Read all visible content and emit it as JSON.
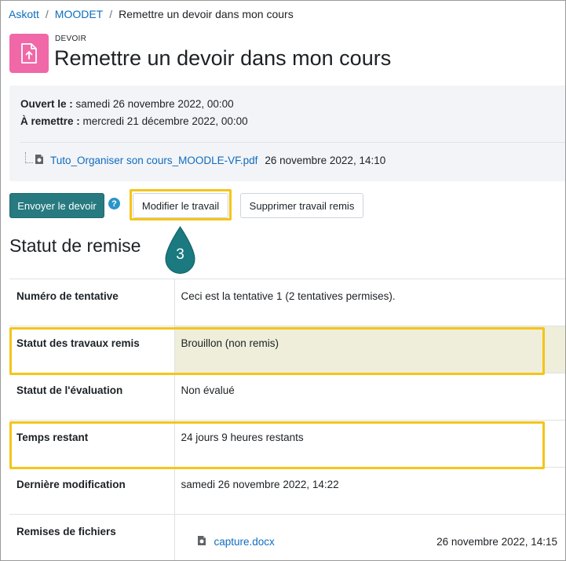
{
  "breadcrumb": [
    {
      "label": "Askott",
      "link": true
    },
    {
      "label": "MOODET",
      "link": true
    },
    {
      "label": "Remettre un devoir dans mon cours",
      "link": false
    }
  ],
  "breadcrumb_separator": "/",
  "activity": {
    "type": "DEVOIR",
    "title": "Remettre un devoir dans mon cours",
    "icon": "assignment-upload-icon",
    "icon_color": "#f068a8"
  },
  "dates": {
    "opened_label": "Ouvert le :",
    "opened_value": "samedi 26 novembre 2022, 00:00",
    "due_label": "À remettre :",
    "due_value": "mercredi 21 décembre 2022, 00:00"
  },
  "attachment": {
    "name": "Tuto_Organiser son cours_MOODLE-VF.pdf",
    "date": "26 novembre 2022, 14:10",
    "icon": "file-icon"
  },
  "actions": {
    "submit_label": "Envoyer le devoir",
    "help_icon": "help-icon",
    "help_glyph": "?",
    "edit_label": "Modifier le travail",
    "delete_label": "Supprimer travail remis",
    "primary_color": "#277a80"
  },
  "callout": {
    "number": "3",
    "color": "#1a7a80"
  },
  "highlight_color": "#f5c518",
  "status": {
    "title": "Statut de remise",
    "rows": [
      {
        "label": "Numéro de tentative",
        "value": "Ceci est la tentative 1 (2 tentatives permises)."
      },
      {
        "label": "Statut des travaux remis",
        "value": "Brouillon (non remis)"
      },
      {
        "label": "Statut de l'évaluation",
        "value": "Non évalué"
      },
      {
        "label": "Temps restant",
        "value": "24 jours 9 heures restants"
      },
      {
        "label": "Dernière modification",
        "value": "samedi 26 novembre 2022, 14:22"
      },
      {
        "label": "Remises de fichiers",
        "file_name": "capture.docx",
        "file_date": "26 novembre 2022, 14:15"
      }
    ]
  }
}
